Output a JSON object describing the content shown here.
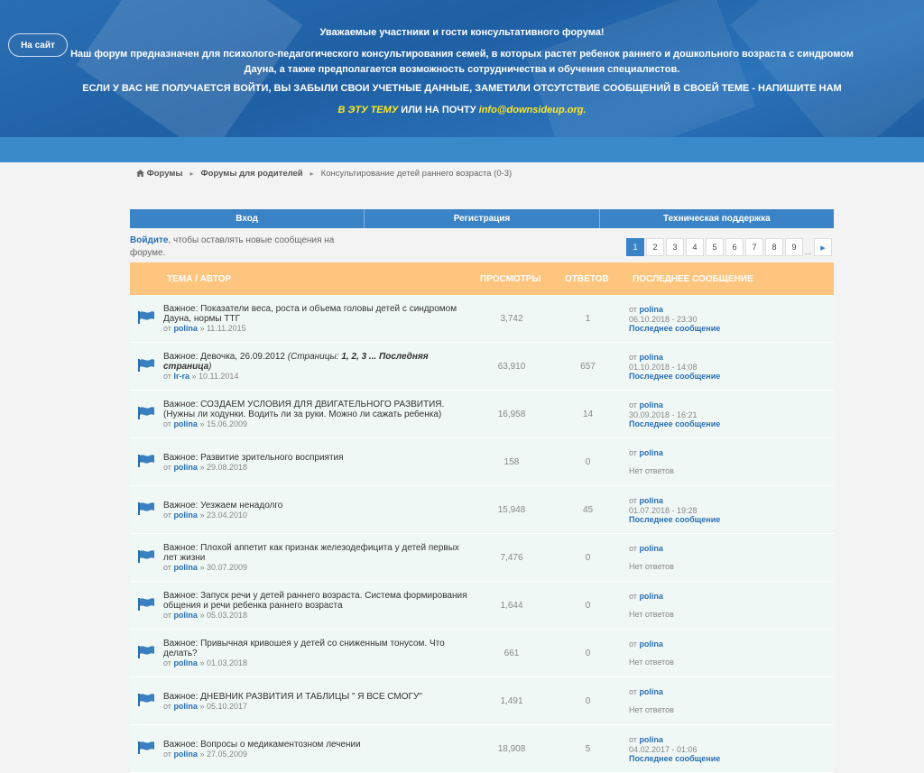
{
  "header": {
    "site_button": "На сайт",
    "line1": "Уважаемые участники и гости консультативного форума!",
    "line2": "Наш форум предназначен для психолого-педагогического консультирования семей, в которых растет ребенок раннего и дошкольного возраста с синдромом Дауна, а также предполагается возможность сотрудничества и обучения специалистов.",
    "line3": "ЕСЛИ У ВАС НЕ ПОЛУЧАЕТСЯ ВОЙТИ, ВЫ ЗАБЫЛИ СВОИ УЧЕТНЫЕ ДАННЫЕ, ЗАМЕТИЛИ ОТСУТСТВИЕ СООБЩЕНИЙ В СВОЕЙ ТЕМЕ - НАПИШИТЕ НАМ",
    "line4_link": "В ЭТУ ТЕМУ",
    "line4_mid": " ИЛИ НА ПОЧТУ ",
    "line4_email": "info@downsideup.org."
  },
  "breadcrumb": {
    "home": "Форумы",
    "parent": "Форумы для родителей",
    "current": "Консультирование детей раннего возраста (0-3)"
  },
  "nav": {
    "login": "Вход",
    "register": "Регистрация",
    "support": "Техническая поддержка"
  },
  "login_msg": {
    "link": "Войдите",
    "rest": ", чтобы оставлять новые сообщения на форуме."
  },
  "pager": {
    "pages": [
      "1",
      "2",
      "3",
      "4",
      "5",
      "6",
      "7",
      "8",
      "9"
    ],
    "active": "1",
    "dots": "...",
    "next": "▸"
  },
  "table": {
    "headers": {
      "topic": "ТЕМА / АВТОР",
      "views": "ПРОСМОТРЫ",
      "replies": "ОТВЕТОВ",
      "last": "ПОСЛЕДНЕЕ СООБЩЕНИЕ"
    },
    "by_prefix": "от ",
    "date_sep": " » ",
    "last_link": "Последнее сообщение",
    "no_replies": "Нет ответов",
    "rows": [
      {
        "title": "Важное: Показатели веса, роста и объема головы детей с синдромом Дауна, нормы ТТГ",
        "author": "polina",
        "date": "11.11.2015",
        "views": "3,742",
        "replies": "1",
        "last_author": "polina",
        "last_date": "06.10.2018 - 23:30",
        "has_replies": true
      },
      {
        "title": "Важное: Девочка, 26.09.2012",
        "pages_prefix": "(Страницы: ",
        "pages_list": "1, 2, 3 ... Последняя страница",
        "pages_suffix": ")",
        "author": "Ir-ra",
        "date": "10.11.2014",
        "views": "63,910",
        "replies": "657",
        "last_author": "polina",
        "last_date": "01.10.2018 - 14:08",
        "has_replies": true
      },
      {
        "title": "Важное: СОЗДАЕМ УСЛОВИЯ ДЛЯ ДВИГАТЕЛЬНОГО РАЗВИТИЯ. (Нужны ли ходунки. Водить ли за руки. Можно ли сажать ребенка)",
        "author": "polina",
        "date": "15.06.2009",
        "views": "16,958",
        "replies": "14",
        "last_author": "polina",
        "last_date": "30.09.2018 - 16:21",
        "has_replies": true
      },
      {
        "title": "Важное: Развитие зрительного восприятия",
        "author": "polina",
        "date": "29.08.2018",
        "views": "158",
        "replies": "0",
        "last_author": "polina",
        "last_date": "",
        "has_replies": false
      },
      {
        "title": "Важное: Уезжаем ненадолго",
        "author": "polina",
        "date": "23.04.2010",
        "views": "15,948",
        "replies": "45",
        "last_author": "polina",
        "last_date": "01.07.2018 - 19:28",
        "has_replies": true
      },
      {
        "title": "Важное: Плохой аппетит как признак железодефицита у детей первых лет жизни",
        "author": "polina",
        "date": "30.07.2009",
        "views": "7,476",
        "replies": "0",
        "last_author": "polina",
        "last_date": "",
        "has_replies": false
      },
      {
        "title": "Важное: Запуск речи у детей раннего возраста. Система формирования общения и речи ребенка раннего возраста",
        "author": "polina",
        "date": "05.03.2018",
        "views": "1,644",
        "replies": "0",
        "last_author": "polina",
        "last_date": "",
        "has_replies": false
      },
      {
        "title": "Важное: Привычная кривошея у детей со сниженным тонусом. Что делать?",
        "author": "polina",
        "date": "01.03.2018",
        "views": "661",
        "replies": "0",
        "last_author": "polina",
        "last_date": "",
        "has_replies": false
      },
      {
        "title": "Важное: ДНЕВНИК РАЗВИТИЯ И ТАБЛИЦЫ \" Я ВСЕ СМОГУ\"",
        "author": "polina",
        "date": "05.10.2017",
        "views": "1,491",
        "replies": "0",
        "last_author": "polina",
        "last_date": "",
        "has_replies": false
      },
      {
        "title": "Важное: Вопросы о медикаментозном лечении",
        "author": "polina",
        "date": "27.05.2009",
        "views": "18,908",
        "replies": "5",
        "last_author": "polina",
        "last_date": "04.02.2017 - 01:06",
        "has_replies": true
      }
    ]
  },
  "colors": {
    "header_blue": "#2a6fb5",
    "nav_blue": "#3b83c7",
    "table_header": "#fec57f",
    "row_bg": "#eff8f4",
    "link": "#2a6fb5",
    "highlight": "#ffe923"
  },
  "icons": {
    "home": "home-icon",
    "topic": "flag-icon",
    "next": "chevron-right-icon"
  }
}
